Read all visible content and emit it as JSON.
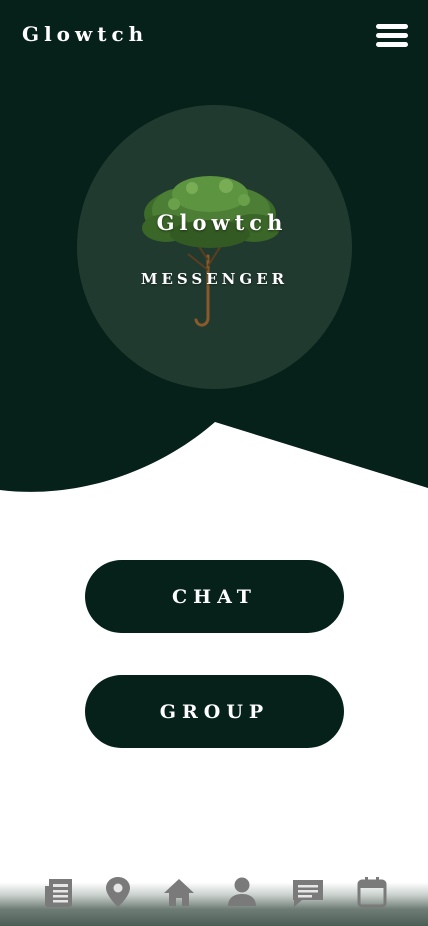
{
  "header": {
    "brand": "Glowtch",
    "menu_icon": "hamburger-menu-icon"
  },
  "logo": {
    "title": "Glowtch",
    "subtitle": "MESSENGER",
    "image": "tree-umbrella-logo"
  },
  "actions": {
    "chat_label": "CHAT",
    "group_label": "GROUP"
  },
  "nav": {
    "items": [
      {
        "icon": "news-icon"
      },
      {
        "icon": "location-pin-icon"
      },
      {
        "icon": "home-icon"
      },
      {
        "icon": "profile-icon"
      },
      {
        "icon": "messages-icon"
      },
      {
        "icon": "calendar-icon"
      }
    ]
  },
  "colors": {
    "hero_background": "#06201a",
    "logo_circle": "#213a30",
    "button_background": "#06201a",
    "button_text": "#ffffff",
    "nav_icon": "#7a7a7a"
  }
}
